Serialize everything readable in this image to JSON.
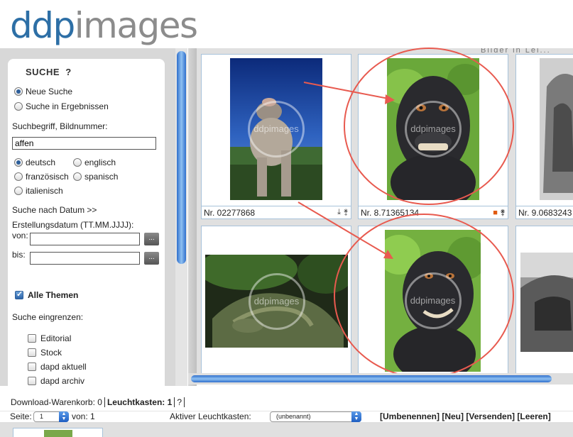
{
  "brand": {
    "part1": "ddp",
    "part2": "images"
  },
  "search": {
    "title": "SUCHE",
    "help": "?",
    "mode_new": "Neue Suche",
    "mode_in_results": "Suche in Ergebnissen",
    "term_label": "Suchbegriff, Bildnummer:",
    "term_value": "affen",
    "languages": [
      "deutsch",
      "englisch",
      "französisch",
      "spanisch",
      "italienisch"
    ],
    "date_search": "Suche nach Datum >>",
    "creation_date_label": "Erstellungsdatum (TT.MM.JJJJ):",
    "from_label": "von:",
    "to_label": "bis:",
    "date_button": "...",
    "all_topics": "Alle Themen",
    "narrow_label": "Suche eingrenzen:",
    "filters": [
      "Editorial",
      "Stock",
      "dapd aktuell",
      "dapd archiv"
    ]
  },
  "gallery": {
    "top_text": "Bilder in Lei...",
    "watermark": "ddpimages",
    "items": [
      {
        "number": "Nr. 02277868"
      },
      {
        "number": "Nr. 8.71365134"
      },
      {
        "number": "Nr. 9.0683243"
      }
    ]
  },
  "bottom": {
    "download_cart": "Download-Warenkorb: 0",
    "lightbox": "Leuchtkasten: 1",
    "help": "?",
    "page_label": "Seite:",
    "page_value": "1",
    "page_of": "von: 1",
    "active_lightbox_label": "Aktiver Leuchtkasten:",
    "active_lightbox_value": "(unbenannt)",
    "actions": [
      "[Umbenennen]",
      "[Neu]",
      "[Versenden]",
      "[Leeren]"
    ]
  },
  "colors": {
    "accent": "#2d6fa6",
    "annotation": "#e85a4f"
  }
}
